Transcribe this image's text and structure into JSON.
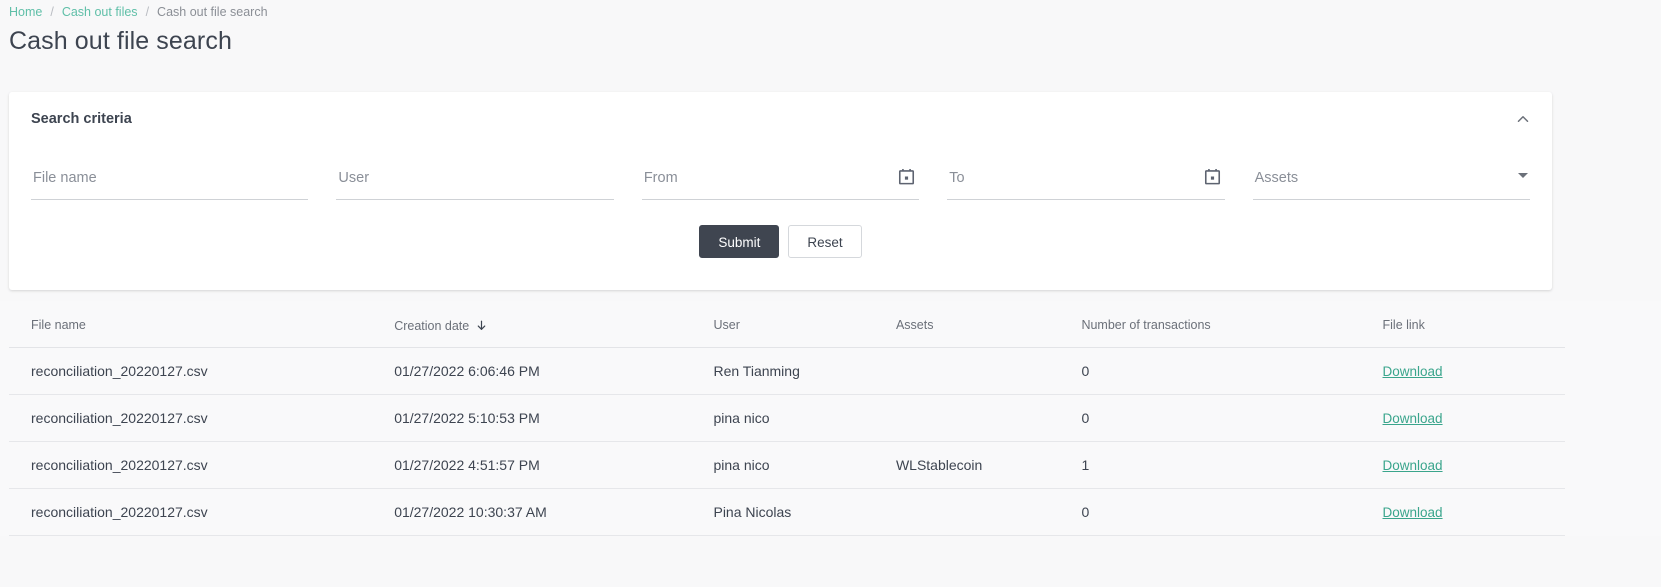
{
  "breadcrumb": {
    "items": [
      {
        "label": "Home",
        "type": "link"
      },
      {
        "label": "Cash out files",
        "type": "link"
      },
      {
        "label": "Cash out file search",
        "type": "current"
      }
    ],
    "separator": "/"
  },
  "page": {
    "title": "Cash out file search"
  },
  "search_card": {
    "title": "Search criteria",
    "collapse_icon": "chevron-up-icon",
    "fields": [
      {
        "name": "file-name",
        "label": "File name",
        "placeholder": "File name",
        "value": "",
        "kind": "text"
      },
      {
        "name": "user",
        "label": "User",
        "placeholder": "User",
        "value": "",
        "kind": "text"
      },
      {
        "name": "from-date",
        "label": "From",
        "placeholder": "From",
        "value": "",
        "kind": "date",
        "icon": "calendar-icon"
      },
      {
        "name": "to-date",
        "label": "To",
        "placeholder": "To",
        "value": "",
        "kind": "date",
        "icon": "calendar-icon"
      },
      {
        "name": "assets",
        "label": "Assets",
        "placeholder": "Assets",
        "value": "",
        "kind": "select",
        "icon": "chevron-down-icon"
      }
    ],
    "submit_label": "Submit",
    "reset_label": "Reset"
  },
  "results": {
    "columns": [
      {
        "key": "file_name",
        "label": "File name",
        "sorted": false
      },
      {
        "key": "creation_date",
        "label": "Creation date",
        "sorted": true,
        "sort_direction": "desc",
        "sort_icon": "arrow-down-icon"
      },
      {
        "key": "user",
        "label": "User",
        "sorted": false
      },
      {
        "key": "assets",
        "label": "Assets",
        "sorted": false
      },
      {
        "key": "number_of_transactions",
        "label": "Number of transactions",
        "sorted": false
      },
      {
        "key": "file_link",
        "label": "File link",
        "sorted": false
      }
    ],
    "rows": [
      {
        "file_name": "reconciliation_20220127.csv",
        "creation_date": "01/27/2022 6:06:46 PM",
        "user": "Ren Tianming",
        "assets": "",
        "number_of_transactions": "0",
        "file_link": "Download"
      },
      {
        "file_name": "reconciliation_20220127.csv",
        "creation_date": "01/27/2022 5:10:53 PM",
        "user": "pina nico",
        "assets": "",
        "number_of_transactions": "0",
        "file_link": "Download"
      },
      {
        "file_name": "reconciliation_20220127.csv",
        "creation_date": "01/27/2022 4:51:57 PM",
        "user": "pina nico",
        "assets": "WLStablecoin",
        "number_of_transactions": "1",
        "file_link": "Download"
      },
      {
        "file_name": "reconciliation_20220127.csv",
        "creation_date": "01/27/2022 10:30:37 AM",
        "user": "Pina Nicolas",
        "assets": "",
        "number_of_transactions": "0",
        "file_link": "Download"
      }
    ]
  },
  "colors": {
    "accent_link": "#5fbfa8",
    "download_link": "#3aa58c",
    "submit_bg": "#3f4550",
    "text_primary": "#3d4450",
    "text_muted": "#8a8f98",
    "page_bg": "#f8f8f9"
  }
}
